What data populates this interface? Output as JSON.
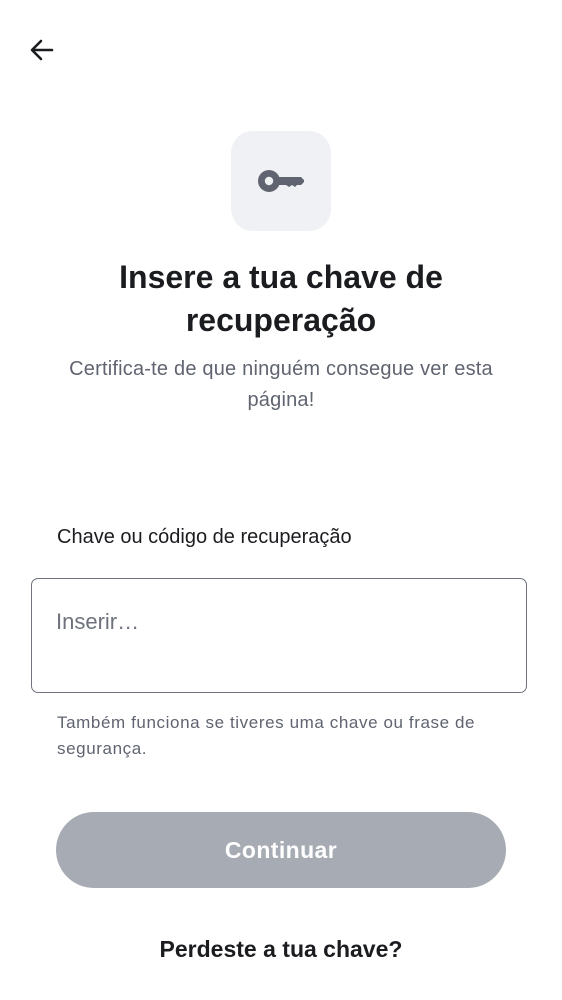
{
  "header": {
    "back_icon": "arrow-left-icon"
  },
  "hero": {
    "icon": "key-icon",
    "icon_color": "#5f6470",
    "tile_color": "#f0f1f4",
    "title": "Insere a tua chave de recuperação",
    "subtitle": "Certifica-te de que ninguém consegue ver esta página!"
  },
  "form": {
    "label": "Chave ou código de recuperação",
    "input_value": "",
    "input_placeholder": "Inserir…",
    "helper": "Também funciona se tiveres uma chave ou frase de segurança."
  },
  "actions": {
    "continue_label": "Continuar",
    "continue_color": "#a7abb3",
    "lost_key_label": "Perdeste a tua chave?"
  }
}
